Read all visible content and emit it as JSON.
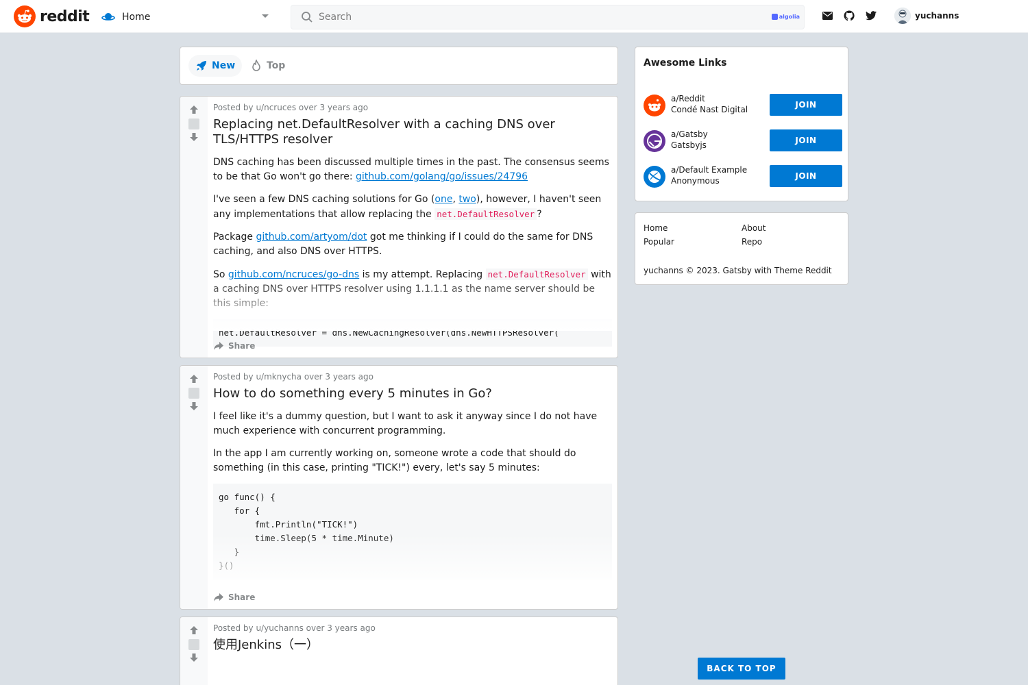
{
  "header": {
    "logo_text": "reddit",
    "home_label": "Home",
    "search_placeholder": "Search",
    "algolia_label": "algolia",
    "username": "yuchanns"
  },
  "sort": {
    "new_label": "New",
    "top_label": "Top"
  },
  "posts": [
    {
      "meta": "Posted by u/ncruces over 3 years ago",
      "title": "Replacing net.DefaultResolver with a caching DNS over TLS/HTTPS resolver",
      "p1_text": "DNS caching has been discussed multiple times in the past. The consensus seems to be that Go won't go there: ",
      "p1_link": "github.com/golang/go/issues/24796",
      "p2_a": "I've seen a few DNS caching solutions for Go (",
      "p2_link1": "one",
      "p2_sep": ", ",
      "p2_link2": "two",
      "p2_b": "), however, I haven't seen any implementations that allow replacing the ",
      "p2_code": "net.DefaultResolver",
      "p2_c": "?",
      "p3_a": "Package ",
      "p3_link": "github.com/artyom/dot",
      "p3_b": " got me thinking if I could do the same for DNS caching, and also DNS over HTTPS.",
      "p4_a": "So ",
      "p4_link": "github.com/ncruces/go-dns",
      "p4_b": " is my attempt. Replacing ",
      "p4_code": "net.DefaultResolver",
      "p4_c": " with a caching DNS over HTTPS resolver using 1.1.1.1 as the name server should be this simple:",
      "code": "net.DefaultResolver = dns.NewCachingResolver(dns.NewHTTPSResolver(",
      "share": "Share"
    },
    {
      "meta": "Posted by u/mknycha over 3 years ago",
      "title": "How to do something every 5 minutes in Go?",
      "p1": "I feel like it's a dummy question, but I want to ask it anyway since I do not have much experience with concurrent programming.",
      "p2": "In the app I am currently working on, someone wrote a code that should do something (in this case, printing \"TICK!\") every, let's say 5 minutes:",
      "code": "go func() {\n   for {\n       fmt.Println(\"TICK!\")\n       time.Sleep(5 * time.Minute)\n   }\n}()",
      "share": "Share"
    },
    {
      "meta": "Posted by u/yuchanns over 3 years ago",
      "title": "使用Jenkins（一）"
    }
  ],
  "sidebar": {
    "links_title": "Awesome Links",
    "links": [
      {
        "name": "a/Reddit",
        "sub": "Condé Nast Digital",
        "join": "JOIN",
        "color": "#ff4500"
      },
      {
        "name": "a/Gatsby",
        "sub": "Gatsbyjs",
        "join": "JOIN",
        "color": "#663399"
      },
      {
        "name": "a/Default Example",
        "sub": "Anonymous",
        "join": "JOIN",
        "color": "#0079d3"
      }
    ],
    "footer_links": [
      "Home",
      "About",
      "Popular",
      "Repo"
    ],
    "copyright": "yuchanns © 2023. Gatsby with Theme Reddit"
  },
  "back_to_top": "BACK TO TOP",
  "colors": {
    "accent": "#0079d3",
    "brand": "#ff4500",
    "background": "#dae0e6"
  }
}
